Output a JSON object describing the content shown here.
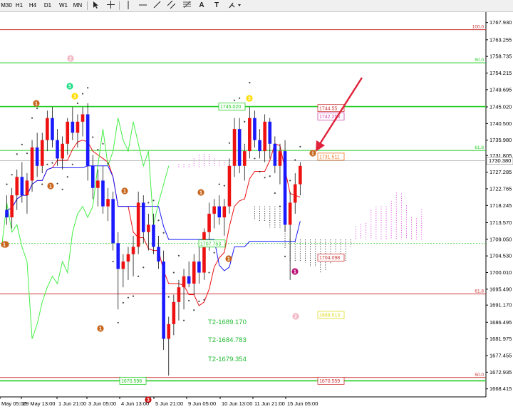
{
  "toolbar": {
    "timeframes": [
      "M30",
      "H1",
      "H4",
      "D1",
      "W1",
      "MN"
    ],
    "tool_icons": [
      "cursor-icon",
      "crosshair-icon",
      "vertical-line-icon",
      "horizontal-line-icon",
      "trendline-icon",
      "channel-icon",
      "fibonacci-icon",
      "text-icon",
      "label-icon",
      "shapes-icon"
    ],
    "text_tool": "A",
    "label_tool": "T"
  },
  "colors": {
    "bull": "#ee1111",
    "bear": "#1a1aff",
    "tenkan": "#ee1111",
    "kijun": "#1a1aff",
    "chikou": "#44ee44",
    "cloud": "#dd44dd",
    "level_green": "#22cc22",
    "level_red": "#cc3333",
    "sar": "#444444",
    "current": "#aaaaaa"
  },
  "chart_data": {
    "type": "candlestick",
    "symbol_note": "",
    "ylim": [
      1667.0,
      1770.0
    ],
    "yticks": [
      "1767.930",
      "1763.255",
      "1758.735",
      "1754.215",
      "1749.695",
      "1745.020",
      "1740.500",
      "1735.980",
      "1731.805",
      "1727.285",
      "1722.765",
      "1718.245",
      "1713.570",
      "1709.050",
      "1704.530",
      "1700.010",
      "1695.490",
      "1691.170",
      "1686.495",
      "1681.975",
      "1677.455",
      "1672.935",
      "1668.415"
    ],
    "current_price": "1730.380",
    "xticks": [
      "May 05:00",
      "29 May 13:00",
      "1 Jun 21:00",
      "3 Jun 05:00",
      "4 Jun 13:00",
      "5 Jun 21:00",
      "9 Jun 05:00",
      "10 Jun 13:00",
      "11 Jun 21:00",
      "15 Jun 05:00"
    ],
    "candles": [
      [
        1717,
        1721,
        1713,
        1715
      ],
      [
        1715,
        1723,
        1712,
        1721
      ],
      [
        1721,
        1728,
        1717,
        1726
      ],
      [
        1726,
        1730,
        1719,
        1721
      ],
      [
        1721,
        1727,
        1716,
        1725
      ],
      [
        1725,
        1736,
        1722,
        1734
      ],
      [
        1734,
        1738,
        1726,
        1729
      ],
      [
        1729,
        1738,
        1727,
        1736
      ],
      [
        1736,
        1744,
        1733,
        1742
      ],
      [
        1742,
        1745,
        1734,
        1736
      ],
      [
        1736,
        1739,
        1729,
        1731
      ],
      [
        1731,
        1737,
        1728,
        1735
      ],
      [
        1735,
        1742,
        1732,
        1741
      ],
      [
        1741,
        1745,
        1736,
        1738
      ],
      [
        1738,
        1743,
        1734,
        1741
      ],
      [
        1741,
        1745,
        1737,
        1743
      ],
      [
        1743,
        1746,
        1725,
        1729
      ],
      [
        1729,
        1732,
        1720,
        1723
      ],
      [
        1723,
        1728,
        1718,
        1725
      ],
      [
        1725,
        1729,
        1716,
        1718
      ],
      [
        1718,
        1723,
        1714,
        1720
      ],
      [
        1720,
        1722,
        1706,
        1708
      ],
      [
        1708,
        1711,
        1690,
        1701
      ],
      [
        1701,
        1705,
        1696,
        1703
      ],
      [
        1703,
        1707,
        1698,
        1705
      ],
      [
        1705,
        1710,
        1699,
        1707
      ],
      [
        1707,
        1722,
        1705,
        1719
      ],
      [
        1719,
        1721,
        1708,
        1711
      ],
      [
        1711,
        1716,
        1706,
        1713
      ],
      [
        1713,
        1716,
        1705,
        1707
      ],
      [
        1707,
        1710,
        1701,
        1703
      ],
      [
        1703,
        1706,
        1679,
        1682
      ],
      [
        1682,
        1688,
        1672,
        1686
      ],
      [
        1686,
        1694,
        1683,
        1692
      ],
      [
        1692,
        1698,
        1687,
        1696
      ],
      [
        1696,
        1701,
        1690,
        1699
      ],
      [
        1699,
        1703,
        1696,
        1697
      ],
      [
        1697,
        1705,
        1694,
        1703
      ],
      [
        1703,
        1708,
        1697,
        1700
      ],
      [
        1700,
        1712,
        1698,
        1711
      ],
      [
        1711,
        1719,
        1706,
        1716
      ],
      [
        1716,
        1720,
        1712,
        1718
      ],
      [
        1718,
        1721,
        1713,
        1715
      ],
      [
        1715,
        1720,
        1710,
        1718
      ],
      [
        1718,
        1731,
        1716,
        1729
      ],
      [
        1729,
        1742,
        1726,
        1739
      ],
      [
        1739,
        1742,
        1727,
        1729
      ],
      [
        1729,
        1735,
        1725,
        1733
      ],
      [
        1733,
        1745,
        1731,
        1742
      ],
      [
        1742,
        1744,
        1734,
        1736
      ],
      [
        1736,
        1739,
        1731,
        1733
      ],
      [
        1733,
        1743,
        1730,
        1741
      ],
      [
        1741,
        1742,
        1731,
        1735
      ],
      [
        1735,
        1737,
        1727,
        1729
      ],
      [
        1729,
        1735,
        1724,
        1733
      ],
      [
        1733,
        1736,
        1711,
        1713
      ],
      [
        1713,
        1722,
        1698,
        1719
      ],
      [
        1719,
        1727,
        1716,
        1724
      ],
      [
        1724,
        1730,
        1721,
        1729
      ]
    ],
    "indicators": {
      "tenkan": "Ichimoku tenkan-sen (red)",
      "kijun": "Ichimoku kijun-sen (blue)",
      "chikou": "Ichimoku chikou span (green)",
      "cloud": "Ichimoku kumo (magenta dotted)",
      "sar": "Parabolic SAR (dark dots)"
    },
    "levels": [
      {
        "price": 1766.0,
        "label": "100.0",
        "color": "#cc3333"
      },
      {
        "price": 1757.0,
        "label": "50.0",
        "color": "#22cc22"
      },
      {
        "price": 1733.2,
        "label": "61.8",
        "color": "#22cc22"
      },
      {
        "price": 1694.2,
        "label": "61.8",
        "color": "#cc3333"
      },
      {
        "price": 1671.5,
        "label": "50.0",
        "color": "#cc3333"
      }
    ],
    "price_tags": [
      {
        "text": "1744.55",
        "price": 1744.7,
        "color": "#cc3333"
      },
      {
        "text": "1742.258",
        "price": 1742.4,
        "color": "#cc44aa"
      },
      {
        "text": "1731.511",
        "price": 1731.5,
        "color": "#ee7722"
      },
      {
        "text": "1704.098",
        "price": 1704.1,
        "color": "#cc3333"
      },
      {
        "text": "1688.513",
        "price": 1688.5,
        "color": "#dddd22"
      },
      {
        "text": "1670.559",
        "price": 1670.6,
        "color": "#cc3333"
      },
      {
        "text": "1745.020",
        "price": 1745.1,
        "color": "#22cc22"
      },
      {
        "text": "1707.753",
        "price": 1707.9,
        "color": "#22cc22"
      },
      {
        "text": "1670.598",
        "price": 1670.6,
        "color": "#22cc22"
      }
    ],
    "targets": [
      "T2-1689.170",
      "T2-1684.783",
      "T2-1679.354"
    ],
    "markers": [
      "2",
      "5",
      "3",
      "1",
      "3",
      "1",
      "1",
      "1",
      "1",
      "1",
      "1",
      "1",
      "1",
      "1",
      "2",
      "3",
      "1"
    ]
  }
}
